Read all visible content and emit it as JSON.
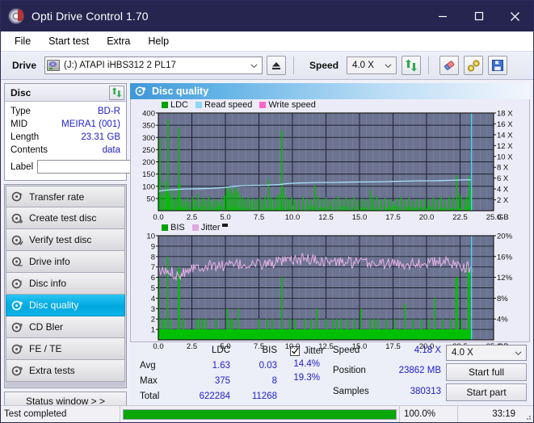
{
  "window": {
    "title": "Opti Drive Control 1.70",
    "icon": "disc-icon",
    "minimize": "minimize",
    "maximize": "maximize",
    "close": "close"
  },
  "menu": [
    "File",
    "Start test",
    "Extra",
    "Help"
  ],
  "toolbar": {
    "drive_label": "Drive",
    "drive_value": "(J:)   ATAPI iHBS312  2 PL17",
    "eject": "eject-icon",
    "speed_label": "Speed",
    "speed_value": "4.0 X",
    "refresh": "refresh-icon",
    "erase": "eraser-icon",
    "tools": "tools-icon",
    "save": "save-icon"
  },
  "disc": {
    "header": "Disc",
    "refresh_icon": "refresh-icon",
    "rows": [
      {
        "key": "Type",
        "value": "BD-R"
      },
      {
        "key": "MID",
        "value": "MEIRA1 (001)"
      },
      {
        "key": "Length",
        "value": "23.31 GB"
      },
      {
        "key": "Contents",
        "value": "data"
      }
    ],
    "label_key": "Label",
    "label_value": "",
    "label_placeholder": "",
    "label_button_icon": "disc-icon"
  },
  "nav": {
    "items": [
      {
        "label": "Transfer rate",
        "icon": "disc-rate-icon",
        "active": false
      },
      {
        "label": "Create test disc",
        "icon": "disc-create-icon",
        "active": false
      },
      {
        "label": "Verify test disc",
        "icon": "disc-verify-icon",
        "active": false
      },
      {
        "label": "Drive info",
        "icon": "drive-info-icon",
        "active": false
      },
      {
        "label": "Disc info",
        "icon": "disc-info-icon",
        "active": false
      },
      {
        "label": "Disc quality",
        "icon": "disc-quality-icon",
        "active": true
      },
      {
        "label": "CD Bler",
        "icon": "cd-bler-icon",
        "active": false
      },
      {
        "label": "FE / TE",
        "icon": "fe-te-icon",
        "active": false
      },
      {
        "label": "Extra tests",
        "icon": "extra-tests-icon",
        "active": false
      }
    ],
    "status_window": "Status window > >"
  },
  "panel": {
    "title": "Disc quality",
    "icon": "disc-quality-icon"
  },
  "chart_data": [
    {
      "type": "line",
      "name": "ldc-chart",
      "title": "",
      "legend": [
        {
          "label": "LDC",
          "color": "#00a000"
        },
        {
          "label": "Read speed",
          "color": "#8fd6f4"
        },
        {
          "label": "Write speed",
          "color": "#ff66cc"
        }
      ],
      "legend_position": "top-left",
      "grid": true,
      "xlabel": "GB",
      "x": [
        0.0,
        2.5,
        5.0,
        7.5,
        10.0,
        12.5,
        15.0,
        17.5,
        20.0,
        22.5,
        25.0
      ],
      "xlim": [
        0,
        25
      ],
      "xticks": [
        "0.0",
        "2.5",
        "5.0",
        "7.5",
        "10.0",
        "12.5",
        "15.0",
        "17.5",
        "20.0",
        "22.5",
        "25.0"
      ],
      "ylabel": "LDC",
      "ylim": [
        0,
        400
      ],
      "yticks": [
        50,
        100,
        150,
        200,
        250,
        300,
        350,
        400
      ],
      "y2label": "Speed",
      "y2lim": [
        0,
        18
      ],
      "y2ticks": [
        "2 X",
        "4 X",
        "6 X",
        "8 X",
        "10 X",
        "12 X",
        "14 X",
        "16 X",
        "18 X"
      ],
      "series": [
        {
          "name": "LDC",
          "color": "#00c000",
          "kind": "spikes",
          "peaks": [
            [
              0.05,
              140
            ],
            [
              0.12,
              295
            ],
            [
              0.25,
              60
            ],
            [
              0.4,
              75
            ],
            [
              0.55,
              120
            ],
            [
              0.62,
              90
            ],
            [
              0.72,
              375
            ],
            [
              0.8,
              70
            ],
            [
              0.92,
              55
            ],
            [
              1.05,
              90
            ],
            [
              1.18,
              45
            ],
            [
              1.35,
              60
            ],
            [
              1.52,
              340
            ],
            [
              1.6,
              110
            ],
            [
              1.75,
              50
            ],
            [
              1.95,
              40
            ],
            [
              2.15,
              55
            ],
            [
              2.35,
              35
            ],
            [
              2.55,
              60
            ],
            [
              2.75,
              45
            ],
            [
              2.95,
              70
            ],
            [
              3.15,
              38
            ],
            [
              3.35,
              52
            ],
            [
              3.55,
              44
            ],
            [
              3.75,
              60
            ],
            [
              3.95,
              35
            ],
            [
              4.15,
              50
            ],
            [
              4.35,
              42
            ],
            [
              4.55,
              38
            ],
            [
              4.75,
              55
            ],
            [
              4.95,
              62
            ],
            [
              5.08,
              95
            ],
            [
              5.2,
              80
            ],
            [
              5.35,
              100
            ],
            [
              5.5,
              70
            ],
            [
              5.65,
              88
            ],
            [
              5.8,
              95
            ],
            [
              5.95,
              78
            ],
            [
              6.1,
              60
            ],
            [
              6.3,
              52
            ],
            [
              6.5,
              45
            ],
            [
              6.7,
              58
            ],
            [
              6.9,
              40
            ],
            [
              7.1,
              50
            ],
            [
              7.3,
              45
            ],
            [
              7.55,
              55
            ],
            [
              7.75,
              42
            ],
            [
              7.95,
              60
            ],
            [
              8.2,
              128
            ],
            [
              8.4,
              55
            ],
            [
              8.6,
              48
            ],
            [
              8.85,
              62
            ],
            [
              9.05,
              70
            ],
            [
              9.2,
              330
            ],
            [
              9.35,
              95
            ],
            [
              9.55,
              60
            ],
            [
              9.75,
              45
            ],
            [
              9.95,
              55
            ],
            [
              10.2,
              48
            ],
            [
              10.5,
              42
            ],
            [
              10.8,
              58
            ],
            [
              11.1,
              50
            ],
            [
              11.4,
              45
            ],
            [
              11.65,
              105
            ],
            [
              11.9,
              60
            ],
            [
              12.2,
              48
            ],
            [
              12.5,
              55
            ],
            [
              12.8,
              42
            ],
            [
              13.1,
              50
            ],
            [
              13.4,
              60
            ],
            [
              13.7,
              45
            ],
            [
              14.0,
              52
            ],
            [
              14.3,
              48
            ],
            [
              14.6,
              58
            ],
            [
              14.9,
              44
            ],
            [
              15.2,
              50
            ],
            [
              15.5,
              42
            ],
            [
              15.8,
              85
            ],
            [
              16.0,
              55
            ],
            [
              16.3,
              60
            ],
            [
              16.6,
              45
            ],
            [
              16.9,
              52
            ],
            [
              17.2,
              48
            ],
            [
              17.5,
              40
            ],
            [
              17.8,
              50
            ],
            [
              18.1,
              58
            ],
            [
              18.4,
              45
            ],
            [
              18.7,
              52
            ],
            [
              19.0,
              40
            ],
            [
              19.3,
              48
            ],
            [
              19.6,
              44
            ],
            [
              19.9,
              50
            ],
            [
              20.2,
              42
            ],
            [
              20.5,
              55
            ],
            [
              20.8,
              48
            ],
            [
              21.1,
              60
            ],
            [
              21.4,
              45
            ],
            [
              21.7,
              58
            ],
            [
              22.0,
              52
            ],
            [
              22.25,
              145
            ],
            [
              22.45,
              70
            ],
            [
              22.6,
              55
            ],
            [
              22.85,
              48
            ],
            [
              23.0,
              60
            ],
            [
              23.2,
              140
            ],
            [
              23.3,
              90
            ]
          ],
          "baseline_noise": 18
        },
        {
          "name": "Read speed",
          "color": "#a8e0f7",
          "kind": "line",
          "axis": "y2",
          "points": [
            [
              0.0,
              3.6
            ],
            [
              0.6,
              3.8
            ],
            [
              1.2,
              3.9
            ],
            [
              2.0,
              4.0
            ],
            [
              3.0,
              4.05
            ],
            [
              4.0,
              4.1
            ],
            [
              5.0,
              4.3
            ],
            [
              5.6,
              4.5
            ],
            [
              6.2,
              4.6
            ],
            [
              7.0,
              4.65
            ],
            [
              8.0,
              4.7
            ],
            [
              9.0,
              4.8
            ],
            [
              9.6,
              5.0
            ],
            [
              10.4,
              5.1
            ],
            [
              11.2,
              5.15
            ],
            [
              12.0,
              5.2
            ],
            [
              13.0,
              5.2
            ],
            [
              14.0,
              5.25
            ],
            [
              15.0,
              5.3
            ],
            [
              16.0,
              5.3
            ],
            [
              17.0,
              5.35
            ],
            [
              17.6,
              5.4
            ],
            [
              18.4,
              5.45
            ],
            [
              19.4,
              5.5
            ],
            [
              20.4,
              5.5
            ],
            [
              21.2,
              5.55
            ],
            [
              21.8,
              5.6
            ],
            [
              22.4,
              5.65
            ],
            [
              23.0,
              5.7
            ],
            [
              23.3,
              5.7
            ]
          ],
          "cursor_x": 23.35,
          "cursor_color": "#4fd0f5"
        }
      ]
    },
    {
      "type": "line",
      "name": "bis-chart",
      "title": "",
      "legend": [
        {
          "label": "BIS",
          "color": "#00a000"
        },
        {
          "label": "Jitter",
          "color": "#e0a8e0"
        }
      ],
      "legend_position": "top-left",
      "grid": true,
      "xlabel": "GB",
      "xlim": [
        0,
        25
      ],
      "xticks": [
        "0.0",
        "2.5",
        "5.0",
        "7.5",
        "10.0",
        "12.5",
        "15.0",
        "17.5",
        "20.0",
        "22.5",
        "25.0"
      ],
      "ylabel": "BIS",
      "ylim": [
        0,
        10
      ],
      "yticks": [
        1,
        2,
        3,
        4,
        5,
        6,
        7,
        8,
        9,
        10
      ],
      "y2label": "Jitter",
      "y2lim": [
        0,
        20
      ],
      "y2ticks": [
        "4%",
        "8%",
        "12%",
        "16%",
        "20%"
      ],
      "series": [
        {
          "name": "BIS",
          "color": "#00c000",
          "kind": "spikes",
          "baseline": 1,
          "peaks": [
            [
              0.05,
              6
            ],
            [
              0.3,
              2
            ],
            [
              0.45,
              2
            ],
            [
              0.7,
              8
            ],
            [
              0.95,
              2
            ],
            [
              1.5,
              6.8
            ],
            [
              1.55,
              7
            ],
            [
              1.85,
              2
            ],
            [
              2.85,
              2
            ],
            [
              3.05,
              2
            ],
            [
              3.3,
              2
            ],
            [
              3.55,
              2
            ],
            [
              4.3,
              2
            ],
            [
              5.15,
              3
            ],
            [
              5.35,
              2
            ],
            [
              5.5,
              2
            ],
            [
              5.95,
              3
            ],
            [
              6.8,
              1
            ],
            [
              7.5,
              2
            ],
            [
              8.1,
              2
            ],
            [
              8.5,
              2
            ],
            [
              9.2,
              6
            ],
            [
              9.8,
              2
            ],
            [
              10.2,
              2
            ],
            [
              10.9,
              2
            ],
            [
              11.4,
              2
            ],
            [
              11.8,
              3
            ],
            [
              12.5,
              2
            ],
            [
              13.0,
              2
            ],
            [
              13.3,
              2
            ],
            [
              13.6,
              2
            ],
            [
              14.1,
              2
            ],
            [
              14.6,
              2
            ],
            [
              15.1,
              3
            ],
            [
              15.8,
              2
            ],
            [
              16.1,
              2
            ],
            [
              16.4,
              2
            ],
            [
              17.0,
              2
            ],
            [
              17.6,
              2
            ],
            [
              18.4,
              3.5
            ],
            [
              19.0,
              2
            ],
            [
              19.6,
              2
            ],
            [
              20.2,
              2
            ],
            [
              20.6,
              4
            ],
            [
              21.2,
              2
            ],
            [
              21.8,
              2
            ],
            [
              22.2,
              6
            ],
            [
              22.3,
              6
            ],
            [
              22.6,
              2
            ],
            [
              23.1,
              7
            ],
            [
              23.2,
              6.5
            ]
          ]
        },
        {
          "name": "Jitter",
          "color": "#e6b0e6",
          "kind": "noisy-line",
          "axis": "y2",
          "trend": [
            [
              0.0,
              13.2
            ],
            [
              1.0,
              13.0
            ],
            [
              1.5,
              12.5
            ],
            [
              2.5,
              14.0
            ],
            [
              4.0,
              14.2
            ],
            [
              6.0,
              14.4
            ],
            [
              8.0,
              14.6
            ],
            [
              10.0,
              15.2
            ],
            [
              11.0,
              15.6
            ],
            [
              12.5,
              15.0
            ],
            [
              14.0,
              14.9
            ],
            [
              16.0,
              14.7
            ],
            [
              18.0,
              14.6
            ],
            [
              20.0,
              14.8
            ],
            [
              21.5,
              15.0
            ],
            [
              23.0,
              14.0
            ],
            [
              23.4,
              13.6
            ]
          ],
          "noise_amp": 1.1
        }
      ]
    }
  ],
  "stats": {
    "col_headers": [
      "LDC",
      "BIS"
    ],
    "rows": [
      {
        "label": "Avg",
        "ldc": "1.63",
        "bis": "0.03"
      },
      {
        "label": "Max",
        "ldc": "375",
        "bis": "8"
      },
      {
        "label": "Total",
        "ldc": "622284",
        "bis": "11268"
      }
    ],
    "jitter": {
      "checked": true,
      "label": "Jitter",
      "avg": "14.4%",
      "max": "19.3%"
    },
    "speed_label": "Speed",
    "speed_value": "4.18 X",
    "position_label": "Position",
    "position_value": "23862 MB",
    "samples_label": "Samples",
    "samples_value": "380313",
    "speed_select": "4.0 X",
    "start_full": "Start full",
    "start_part": "Start part"
  },
  "statusbar": {
    "message": "Test completed",
    "progress": 100.0,
    "progress_text": "100.0%",
    "elapsed": "33:19"
  },
  "colors": {
    "title_bg": "#252550",
    "accent": "#00a8e0",
    "value_blue": "#2020cc",
    "green": "#00c000",
    "progress_green": "#0aa60a",
    "plot_bg": "#6b7390"
  }
}
